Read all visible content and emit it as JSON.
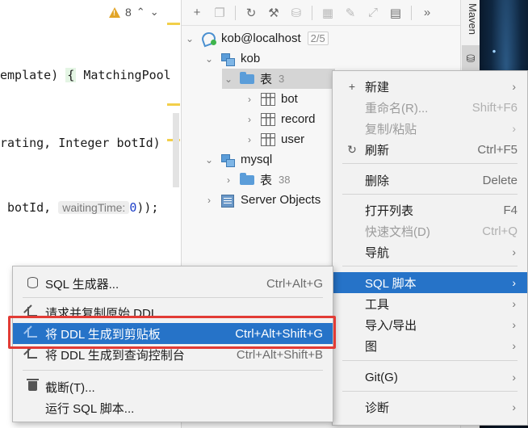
{
  "editor": {
    "warnings_count": "8",
    "line1_text": "emplate) ",
    "line1_brace": "{",
    "line1_rest": " MatchingPool",
    "line2_text": "rating, Integer botId)",
    "line3_prefix": " botId, ",
    "line3_hint": "waitingTime:",
    "line3_num": "0",
    "line3_suffix": "));"
  },
  "database_tree": {
    "connection": {
      "label": "kob@localhost",
      "badge": "2/5"
    },
    "nodes": [
      {
        "label": "kob"
      },
      {
        "label": "表",
        "count": "3"
      },
      {
        "label": "bot"
      },
      {
        "label": "record"
      },
      {
        "label": "user"
      },
      {
        "label": "mysql"
      },
      {
        "label": "表",
        "count": "38"
      },
      {
        "label": "Server Objects"
      }
    ]
  },
  "right_strip": {
    "maven_label": "Maven"
  },
  "context_menu": {
    "items": [
      {
        "icon": "plus-icon",
        "label": "新建",
        "shortcut": "",
        "submenu": true,
        "disabled": false
      },
      {
        "icon": "",
        "label": "重命名(R)...",
        "shortcut": "Shift+F6",
        "submenu": false,
        "disabled": true
      },
      {
        "icon": "",
        "label": "复制/粘贴",
        "shortcut": "",
        "submenu": true,
        "disabled": true
      },
      {
        "icon": "refresh-icon",
        "label": "刷新",
        "shortcut": "Ctrl+F5",
        "submenu": false,
        "disabled": false
      },
      {
        "icon": "",
        "label": "删除",
        "shortcut": "Delete",
        "submenu": false,
        "disabled": false
      },
      {
        "icon": "",
        "label": "打开列表",
        "shortcut": "F4",
        "submenu": false,
        "disabled": false
      },
      {
        "icon": "",
        "label": "快速文档(D)",
        "shortcut": "Ctrl+Q",
        "submenu": false,
        "disabled": true
      },
      {
        "icon": "",
        "label": "导航",
        "shortcut": "",
        "submenu": true,
        "disabled": false
      },
      {
        "icon": "",
        "label": "SQL 脚本",
        "shortcut": "",
        "submenu": true,
        "disabled": false,
        "highlighted": true
      },
      {
        "icon": "",
        "label": "工具",
        "shortcut": "",
        "submenu": true,
        "disabled": false
      },
      {
        "icon": "",
        "label": "导入/导出",
        "shortcut": "",
        "submenu": true,
        "disabled": false
      },
      {
        "icon": "",
        "label": "图",
        "shortcut": "",
        "submenu": true,
        "disabled": false
      },
      {
        "icon": "",
        "label": "Git(G)",
        "shortcut": "",
        "submenu": true,
        "disabled": false
      },
      {
        "icon": "",
        "label": "诊断",
        "shortcut": "",
        "submenu": true,
        "disabled": false
      }
    ]
  },
  "sql_submenu": {
    "items": [
      {
        "icon": "sql-generator-icon",
        "label": "SQL 生成器...",
        "shortcut": "Ctrl+Alt+G"
      },
      {
        "icon": "arrow-out-icon",
        "label": "请求并复制原始 DDL",
        "shortcut": ""
      },
      {
        "icon": "arrow-out-icon",
        "label": "将 DDL 生成到剪贴板",
        "shortcut": "Ctrl+Alt+Shift+G",
        "highlighted": true
      },
      {
        "icon": "arrow-out-icon",
        "label": "将 DDL 生成到查询控制台",
        "shortcut": "Ctrl+Alt+Shift+B"
      },
      {
        "icon": "trash-icon",
        "label": "截断(T)...",
        "shortcut": ""
      },
      {
        "icon": "",
        "label": "运行 SQL 脚本...",
        "shortcut": ""
      }
    ]
  },
  "colors": {
    "highlight": "#2673c8",
    "annotation_frame": "#e23b35",
    "folder": "#5b9dd9"
  }
}
